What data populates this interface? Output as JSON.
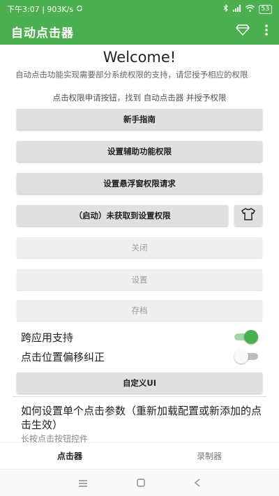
{
  "status_bar": {
    "time_speed": "下午3:07 | 903K/s",
    "battery": "53"
  },
  "app_bar": {
    "title": "自动点击器",
    "icons": [
      "diamond-icon",
      "more-vert-icon"
    ]
  },
  "main": {
    "welcome": "Welcome!",
    "desc": "自动点击功能实现需要部分系统权限的支持，请您授予相应的权限",
    "desc2": "点击权限申请按钮，找到 自动点击器 并授予权限",
    "buttons": {
      "guide": "新手指南",
      "accessibility": "设置辅助功能权限",
      "overlay": "设置悬浮窗权限请求",
      "start": "（启动）未获取到设置权限",
      "close": "关闭",
      "settings": "设置",
      "archive": "存档",
      "custom_ui": "自定义UI"
    },
    "toggles": {
      "cross_app": {
        "label": "跨应用支持",
        "on": true
      },
      "offset": {
        "label": "点击位置偏移纠正",
        "on": false
      }
    },
    "howto_title": "如何设置单个点击参数（重新加载配置或新添加的点击生效）",
    "howto_sub": "长按点击按钮控件"
  },
  "bottom_nav": {
    "tab1": "点击器",
    "tab2": "录制器"
  },
  "colors": {
    "primary": "#4caf50",
    "button_bg": "#e0e0e0",
    "disabled_text": "#9e9e9e"
  }
}
